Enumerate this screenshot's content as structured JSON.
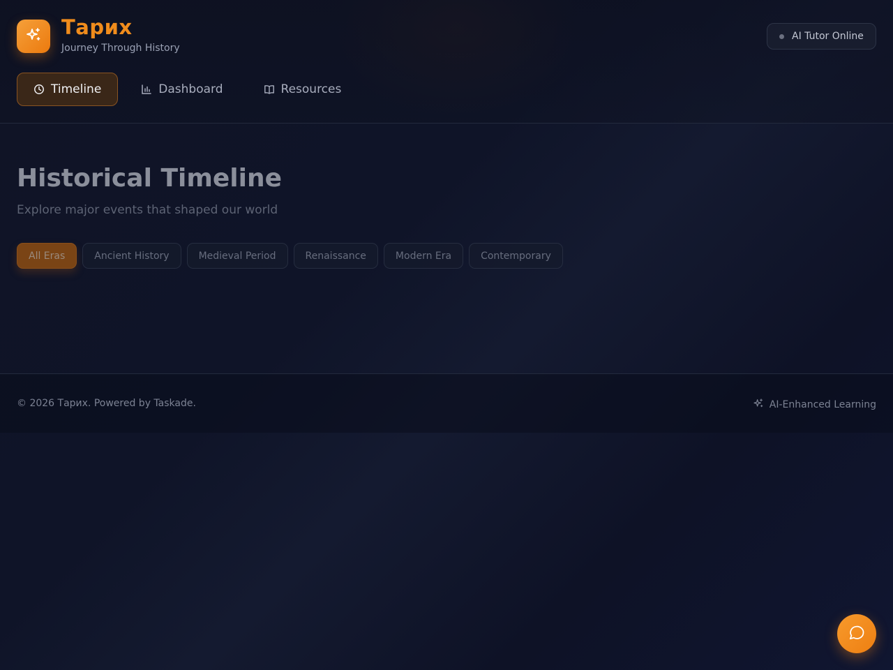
{
  "brand": {
    "name": "Тарих",
    "tagline": "Journey Through History",
    "logo_icon": "sparkles-icon",
    "accent": "#f08c1c"
  },
  "status": {
    "label": "AI Tutor Online",
    "dot_color": "#6b7080"
  },
  "nav": {
    "items": [
      {
        "label": "Timeline",
        "icon": "clock-icon",
        "active": true
      },
      {
        "label": "Dashboard",
        "icon": "bar-chart-icon",
        "active": false
      },
      {
        "label": "Resources",
        "icon": "book-open-icon",
        "active": false
      }
    ]
  },
  "main": {
    "title": "Historical Timeline",
    "subtitle": "Explore major events that shaped our world",
    "filters": [
      {
        "label": "All Eras",
        "active": true
      },
      {
        "label": "Ancient History",
        "active": false
      },
      {
        "label": "Medieval Period",
        "active": false
      },
      {
        "label": "Renaissance",
        "active": false
      },
      {
        "label": "Modern Era",
        "active": false
      },
      {
        "label": "Contemporary",
        "active": false
      }
    ]
  },
  "footer": {
    "copyright": "© 2026 Тарих. Powered by Taskade.",
    "badge": "AI-Enhanced Learning",
    "badge_icon": "sparkles-icon"
  },
  "chat_fab": {
    "icon": "chat-bubble-icon"
  }
}
